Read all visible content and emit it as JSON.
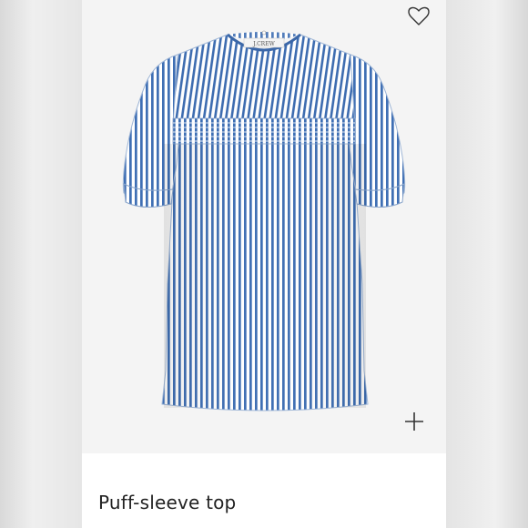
{
  "product": {
    "title": "Puff-sleeve top",
    "image_alt": "Blue and white striped puff-sleeve top",
    "brand_label": "J.CREW"
  },
  "icons": {
    "favorite": "heart-outline-icon",
    "add": "plus-icon"
  },
  "colors": {
    "stripe_blue": "#3f6fb4",
    "stripe_white": "#ffffff",
    "background": "#f4f4f4"
  }
}
